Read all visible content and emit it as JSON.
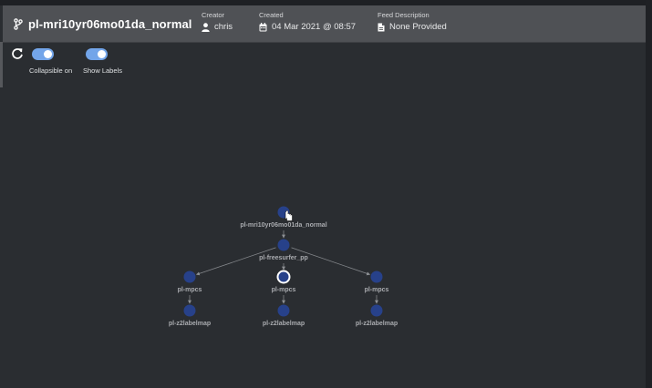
{
  "header": {
    "title": "pl-mri10yr06mo01da_normal",
    "creator_label": "Creator",
    "creator_value": "chris",
    "created_label": "Created",
    "created_value": "04 Mar 2021 @ 08:57",
    "description_label": "Feed Description",
    "description_value": "None Provided"
  },
  "controls": {
    "refresh_icon": "refresh-icon",
    "toggles": [
      {
        "label": "Collapsible on",
        "on": true
      },
      {
        "label": "Show Labels",
        "on": true
      }
    ]
  },
  "graph": {
    "nodes": [
      {
        "id": "root",
        "label": "pl-mri10yr06mo01da_normal"
      },
      {
        "id": "fs",
        "label": "pl-freesurfer_pp"
      },
      {
        "id": "m1",
        "label": "pl-mpcs"
      },
      {
        "id": "m2",
        "label": "pl-mpcs",
        "selected": true
      },
      {
        "id": "m3",
        "label": "pl-mpcs"
      },
      {
        "id": "z1",
        "label": "pl-z2labelmap"
      },
      {
        "id": "z2",
        "label": "pl-z2labelmap"
      },
      {
        "id": "z3",
        "label": "pl-z2labelmap"
      }
    ],
    "edges": [
      [
        "root",
        "fs"
      ],
      [
        "fs",
        "m1"
      ],
      [
        "fs",
        "m2"
      ],
      [
        "fs",
        "m3"
      ],
      [
        "m1",
        "z1"
      ],
      [
        "m2",
        "z2"
      ],
      [
        "m3",
        "z3"
      ]
    ]
  },
  "colors": {
    "background": "#2a2d31",
    "header": "#4f5155",
    "node_fill": "#27418a",
    "toggle_on": "#73a5e9",
    "label": "#a9abaf"
  }
}
